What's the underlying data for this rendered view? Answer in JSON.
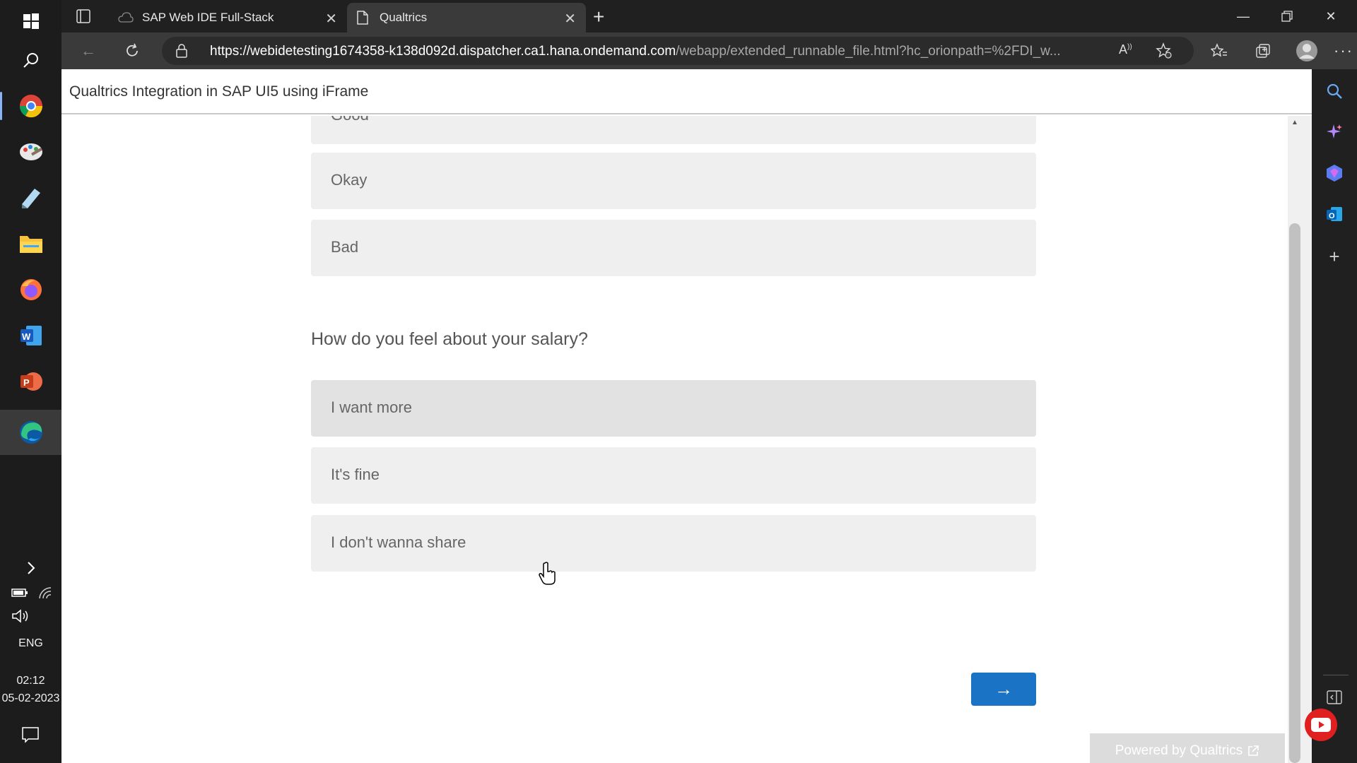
{
  "taskbar": {
    "lang": "ENG",
    "time": "02:12",
    "date": "05-02-2023"
  },
  "browser": {
    "tabs": [
      {
        "label": "SAP Web IDE Full-Stack"
      },
      {
        "label": "Qualtrics"
      }
    ],
    "url_host": "https://webidetesting1674358-k138d092d.dispatcher.ca1.hana.ondemand.com",
    "url_path": "/webapp/extended_runnable_file.html?hc_orionpath=%2FDI_w..."
  },
  "app": {
    "title": "Qualtrics Integration in SAP UI5 using iFrame"
  },
  "survey": {
    "prev_choices": [
      {
        "label": "Good"
      },
      {
        "label": "Okay"
      },
      {
        "label": "Bad"
      }
    ],
    "question": "How do you feel about your salary?",
    "choices": [
      {
        "label": "I want more"
      },
      {
        "label": "It's fine"
      },
      {
        "label": "I don't wanna share"
      }
    ],
    "next_label": "→",
    "powered_by": "Powered by Qualtrics"
  },
  "colors": {
    "accent": "#1a73c4",
    "choice_bg": "#efefef"
  }
}
